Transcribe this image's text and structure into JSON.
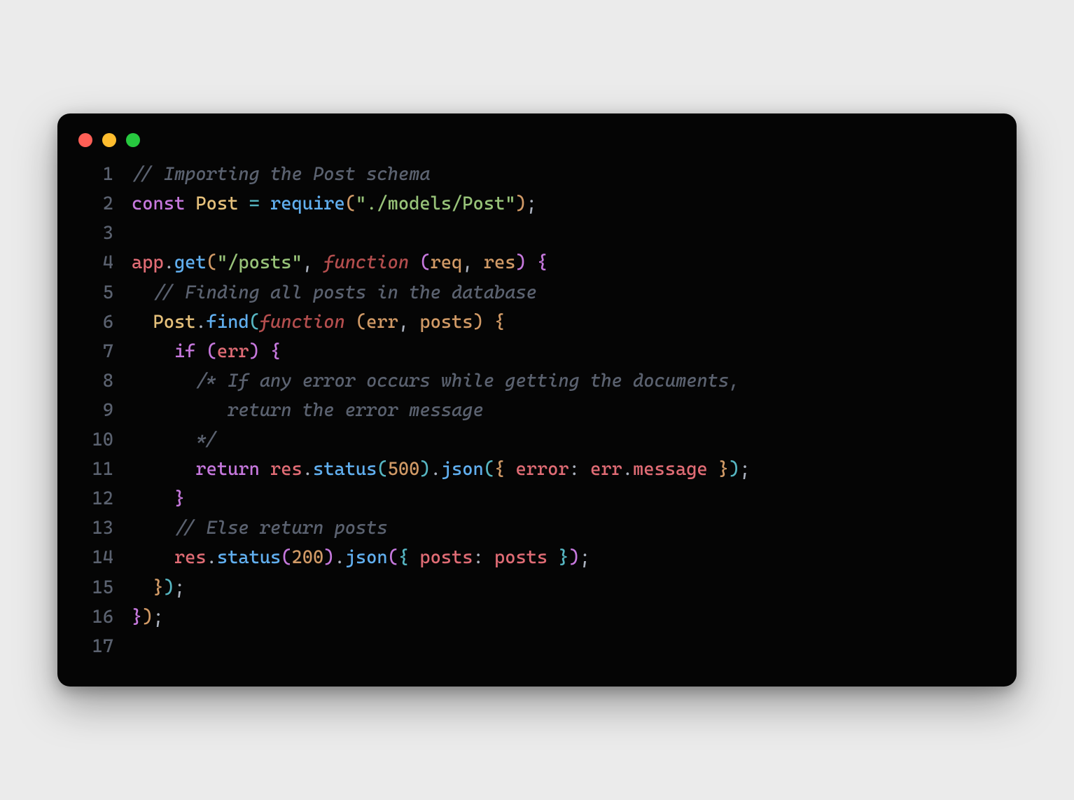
{
  "window": {
    "dot_colors": {
      "close": "#ff5f56",
      "minimize": "#ffbd2e",
      "zoom": "#27c93f"
    }
  },
  "code": {
    "lines": [
      {
        "n": "1",
        "tokens": [
          [
            "cm",
            "// Importing the Post schema"
          ]
        ]
      },
      {
        "n": "2",
        "tokens": [
          [
            "kw",
            "const"
          ],
          [
            "pn",
            " "
          ],
          [
            "idy",
            "Post"
          ],
          [
            "pn",
            " "
          ],
          [
            "op",
            "="
          ],
          [
            "pn",
            " "
          ],
          [
            "idb",
            "require"
          ],
          [
            "brR",
            "("
          ],
          [
            "str",
            "\"./models/Post\""
          ],
          [
            "brR",
            ")"
          ],
          [
            "pn",
            ";"
          ]
        ]
      },
      {
        "n": "3",
        "tokens": [
          [
            "pn",
            ""
          ]
        ]
      },
      {
        "n": "4",
        "tokens": [
          [
            "red",
            "app"
          ],
          [
            "pn",
            "."
          ],
          [
            "idb",
            "get"
          ],
          [
            "brR",
            "("
          ],
          [
            "str",
            "\"/posts\""
          ],
          [
            "pn",
            ", "
          ],
          [
            "fnk",
            "function"
          ],
          [
            "pn",
            " "
          ],
          [
            "brP",
            "("
          ],
          [
            "par",
            "req"
          ],
          [
            "pn",
            ", "
          ],
          [
            "par",
            "res"
          ],
          [
            "brP",
            ")"
          ],
          [
            "pn",
            " "
          ],
          [
            "brP",
            "{"
          ]
        ]
      },
      {
        "n": "5",
        "tokens": [
          [
            "pn",
            "  "
          ],
          [
            "cm",
            "// Finding all posts in the database"
          ]
        ]
      },
      {
        "n": "6",
        "tokens": [
          [
            "pn",
            "  "
          ],
          [
            "idy",
            "Post"
          ],
          [
            "pn",
            "."
          ],
          [
            "idb",
            "find"
          ],
          [
            "brB",
            "("
          ],
          [
            "fnk",
            "function"
          ],
          [
            "pn",
            " "
          ],
          [
            "brR",
            "("
          ],
          [
            "par",
            "err"
          ],
          [
            "pn",
            ", "
          ],
          [
            "par",
            "posts"
          ],
          [
            "brR",
            ")"
          ],
          [
            "pn",
            " "
          ],
          [
            "brR",
            "{"
          ]
        ]
      },
      {
        "n": "7",
        "tokens": [
          [
            "pn",
            "    "
          ],
          [
            "kw",
            "if"
          ],
          [
            "pn",
            " "
          ],
          [
            "brP",
            "("
          ],
          [
            "red",
            "err"
          ],
          [
            "brP",
            ")"
          ],
          [
            "pn",
            " "
          ],
          [
            "brP",
            "{"
          ]
        ]
      },
      {
        "n": "8",
        "tokens": [
          [
            "pn",
            "      "
          ],
          [
            "cm",
            "/* If any error occurs while getting the documents,"
          ]
        ]
      },
      {
        "n": "9",
        "tokens": [
          [
            "cm",
            "         return the error message"
          ]
        ]
      },
      {
        "n": "10",
        "tokens": [
          [
            "pn",
            "      "
          ],
          [
            "cm",
            "*/"
          ]
        ]
      },
      {
        "n": "11",
        "tokens": [
          [
            "pn",
            "      "
          ],
          [
            "kw",
            "return"
          ],
          [
            "pn",
            " "
          ],
          [
            "red",
            "res"
          ],
          [
            "pn",
            "."
          ],
          [
            "idb",
            "status"
          ],
          [
            "brB",
            "("
          ],
          [
            "num",
            "500"
          ],
          [
            "brB",
            ")"
          ],
          [
            "pn",
            "."
          ],
          [
            "idb",
            "json"
          ],
          [
            "brB",
            "("
          ],
          [
            "brR",
            "{"
          ],
          [
            "pn",
            " "
          ],
          [
            "red",
            "error"
          ],
          [
            "pn",
            ": "
          ],
          [
            "red",
            "err"
          ],
          [
            "pn",
            "."
          ],
          [
            "red",
            "message"
          ],
          [
            "pn",
            " "
          ],
          [
            "brR",
            "}"
          ],
          [
            "brB",
            ")"
          ],
          [
            "pn",
            ";"
          ]
        ]
      },
      {
        "n": "12",
        "tokens": [
          [
            "pn",
            "    "
          ],
          [
            "brP",
            "}"
          ]
        ]
      },
      {
        "n": "13",
        "tokens": [
          [
            "pn",
            "    "
          ],
          [
            "cm",
            "// Else return posts"
          ]
        ]
      },
      {
        "n": "14",
        "tokens": [
          [
            "pn",
            "    "
          ],
          [
            "red",
            "res"
          ],
          [
            "pn",
            "."
          ],
          [
            "idb",
            "status"
          ],
          [
            "brP",
            "("
          ],
          [
            "num",
            "200"
          ],
          [
            "brP",
            ")"
          ],
          [
            "pn",
            "."
          ],
          [
            "idb",
            "json"
          ],
          [
            "brP",
            "("
          ],
          [
            "brB",
            "{"
          ],
          [
            "pn",
            " "
          ],
          [
            "red",
            "posts"
          ],
          [
            "pn",
            ": "
          ],
          [
            "red",
            "posts"
          ],
          [
            "pn",
            " "
          ],
          [
            "brB",
            "}"
          ],
          [
            "brP",
            ")"
          ],
          [
            "pn",
            ";"
          ]
        ]
      },
      {
        "n": "15",
        "tokens": [
          [
            "pn",
            "  "
          ],
          [
            "brR",
            "}"
          ],
          [
            "brB",
            ")"
          ],
          [
            "pn",
            ";"
          ]
        ]
      },
      {
        "n": "16",
        "tokens": [
          [
            "brP",
            "}"
          ],
          [
            "brR",
            ")"
          ],
          [
            "pn",
            ";"
          ]
        ]
      },
      {
        "n": "17",
        "tokens": [
          [
            "pn",
            ""
          ]
        ]
      }
    ]
  }
}
